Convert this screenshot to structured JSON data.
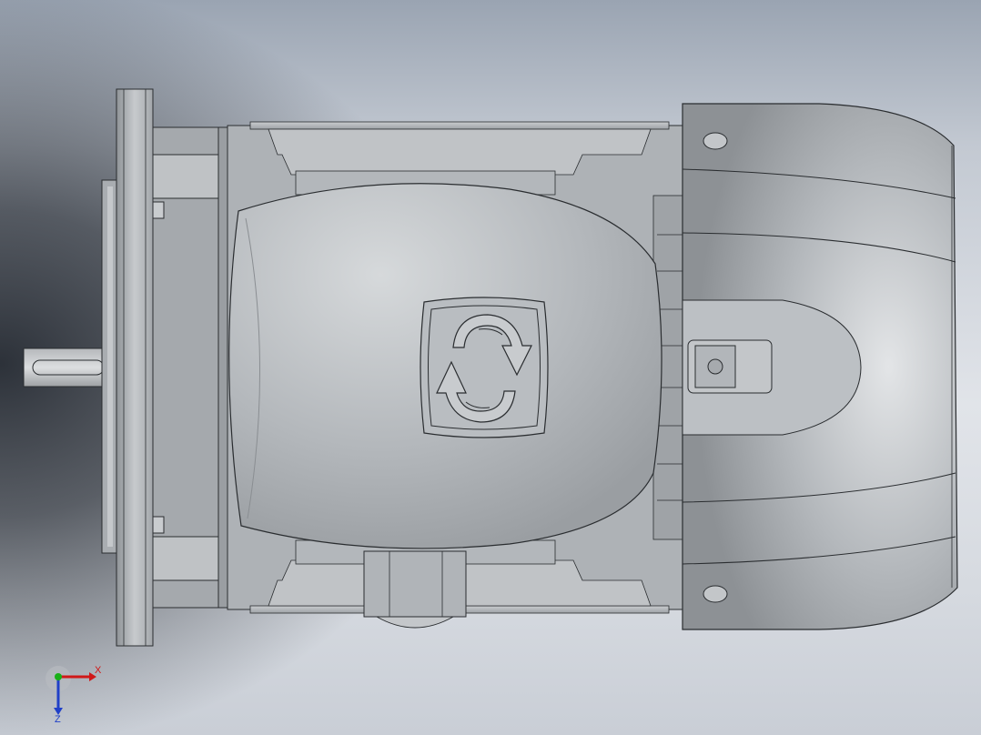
{
  "viewport": {
    "view_name": "motor-assembly-view"
  },
  "triad": {
    "x_label": "X",
    "z_label": "Z",
    "colors": {
      "x_axis": "#d01818",
      "y_axis": "#18b018",
      "z_axis": "#2040c8"
    }
  },
  "model_colors": {
    "body": "#b8bcc0",
    "body_dark": "#8e9296",
    "body_light": "#d9dcde",
    "edge": "#2a2d30"
  },
  "icons": [
    "rotation-direction-icon"
  ]
}
